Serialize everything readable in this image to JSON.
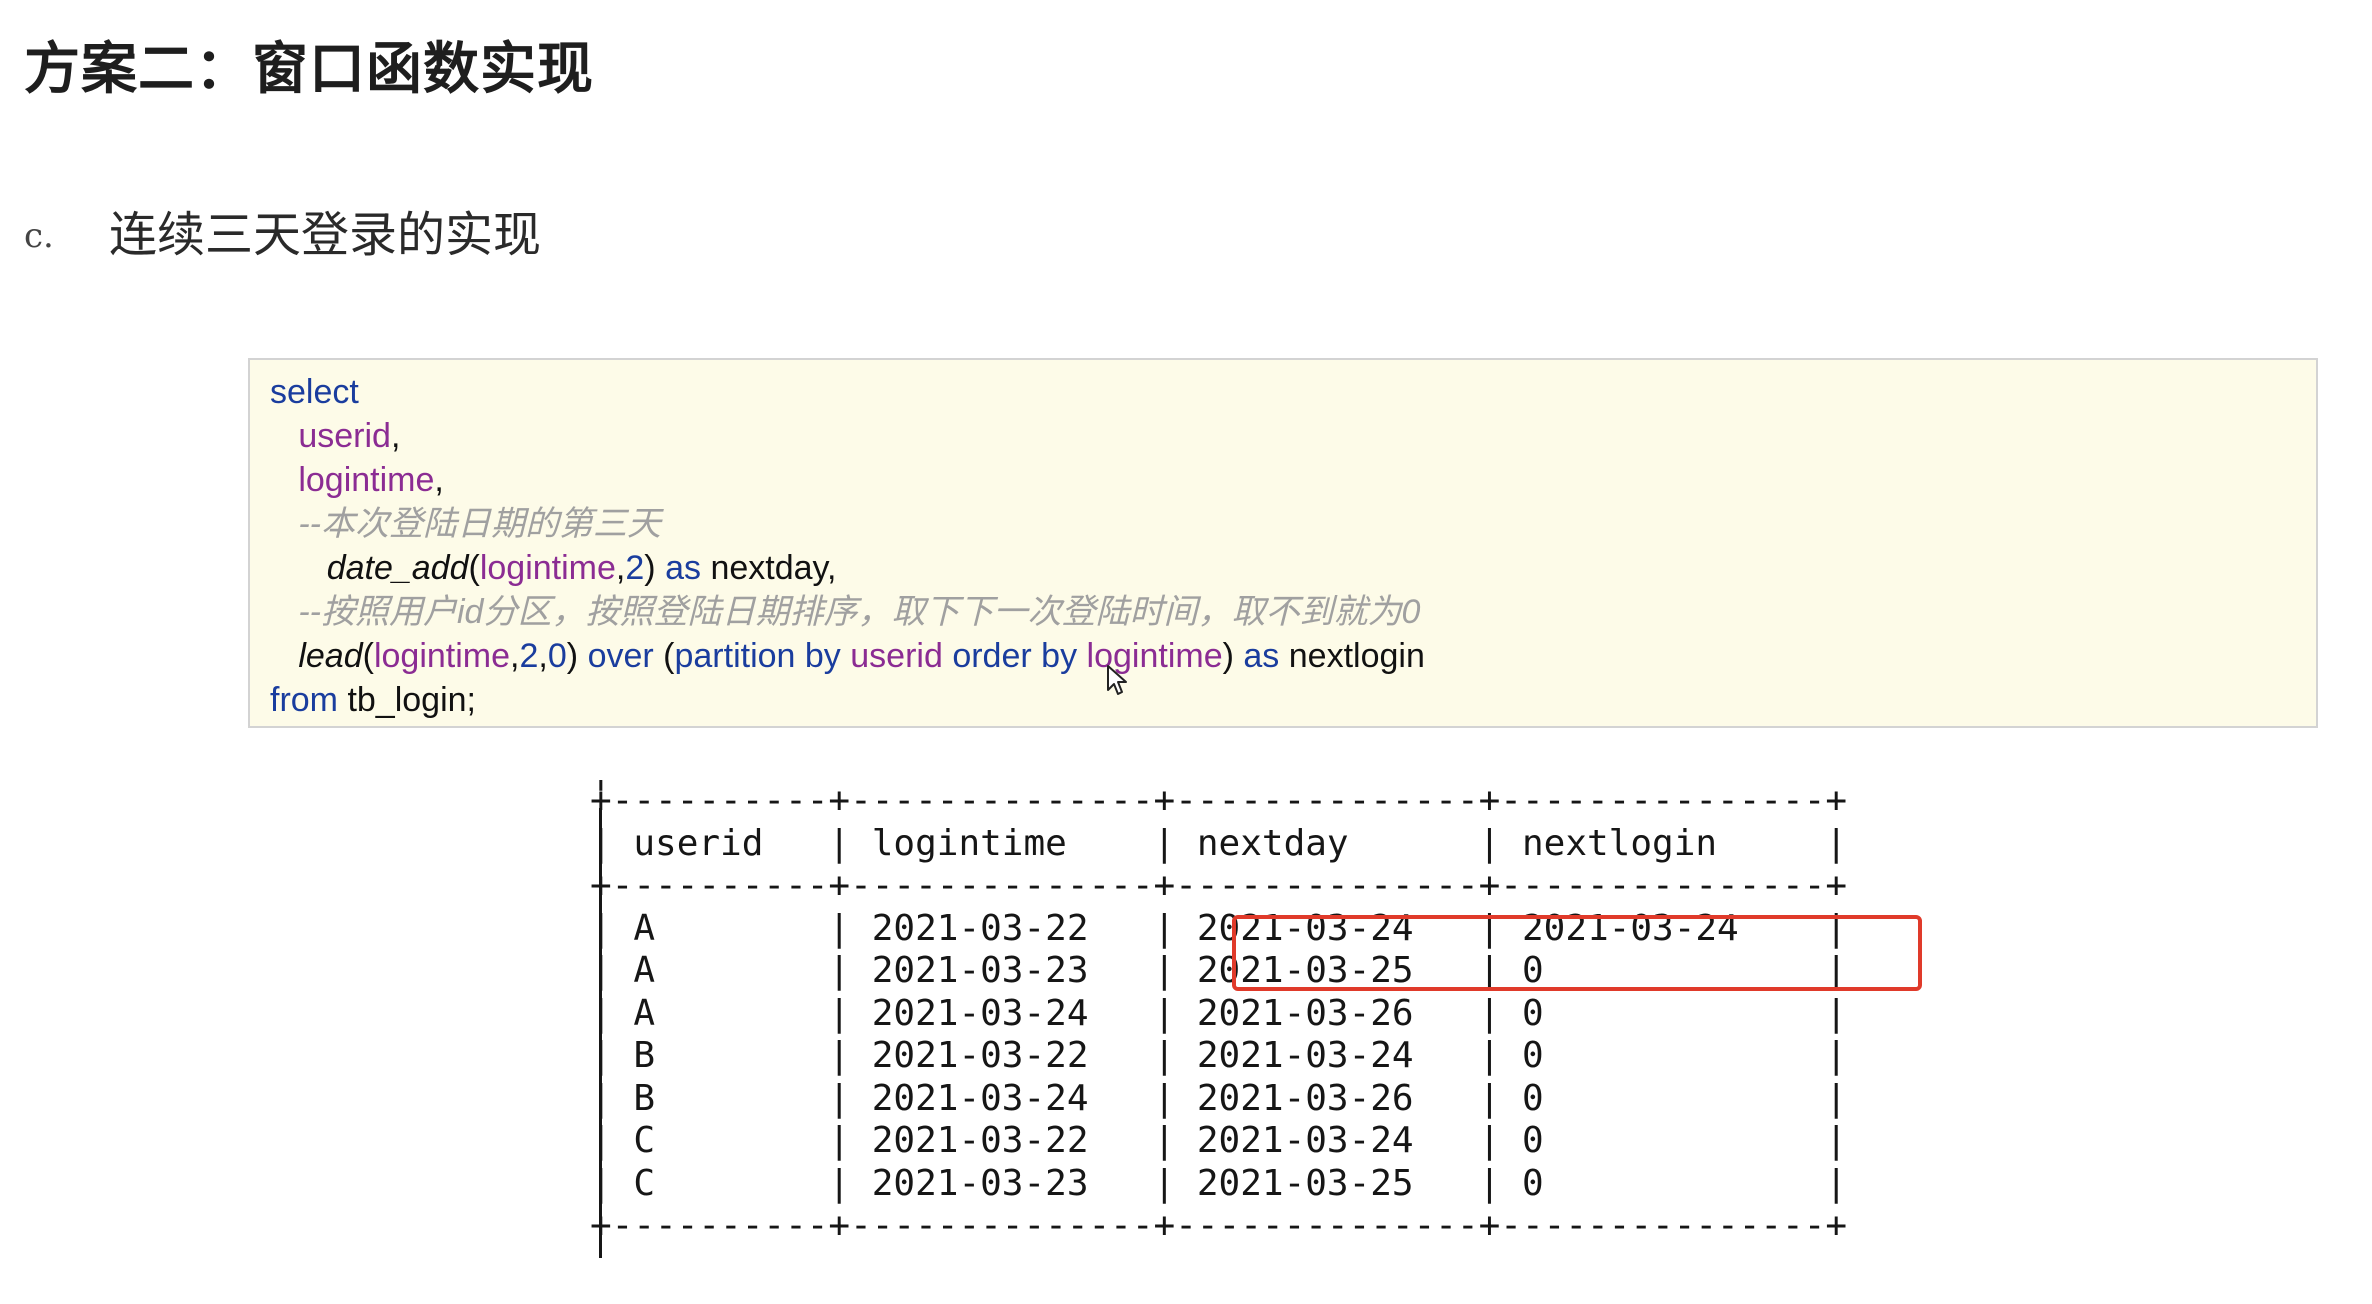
{
  "heading": "方案二：窗口函数实现",
  "subheading": {
    "marker": "c.",
    "text": "连续三天登录的实现"
  },
  "code": {
    "select_kw": "select",
    "line_userid": "userid",
    "comma": ",",
    "line_logintime": "logintime",
    "comment1": "--本次登陆日期的第三天",
    "fn_date_add": "date_add",
    "paren_open": "(",
    "arg_logintime": "logintime",
    "arg_2": "2",
    "paren_close": ")",
    "as_kw": "as",
    "alias_nextday": "nextday,",
    "comment2": "--按照用户id分区，按照登陆日期排序，取下下一次登陆时间，取不到就为0",
    "fn_lead": "lead",
    "arg_0": "0",
    "over_kw": "over",
    "partition_by_kw": "partition by",
    "arg_userid": "userid",
    "order_kw": "order",
    "by_kw": "by",
    "alias_nextlogin": "nextlogin",
    "from_kw": "from",
    "table_name": "tb_login;"
  },
  "result_table": {
    "partial_top": "|    ------          -------           -----          ---------     |",
    "border": "+----------+--------------+--------------+---------------+",
    "header": "| userid   | logintime    | nextday      | nextlogin     |",
    "columns": [
      "userid",
      "logintime",
      "nextday",
      "nextlogin"
    ],
    "rows": [
      [
        "A",
        "2021-03-22",
        "2021-03-24",
        "2021-03-24"
      ],
      [
        "A",
        "2021-03-23",
        "2021-03-25",
        "0"
      ],
      [
        "A",
        "2021-03-24",
        "2021-03-26",
        "0"
      ],
      [
        "B",
        "2021-03-22",
        "2021-03-24",
        "0"
      ],
      [
        "B",
        "2021-03-24",
        "2021-03-26",
        "0"
      ],
      [
        "C",
        "2021-03-22",
        "2021-03-24",
        "0"
      ],
      [
        "C",
        "2021-03-23",
        "2021-03-25",
        "0"
      ]
    ],
    "highlight_color": "#e03a2a"
  },
  "icons": {
    "cursor": "mouse-pointer-icon"
  }
}
